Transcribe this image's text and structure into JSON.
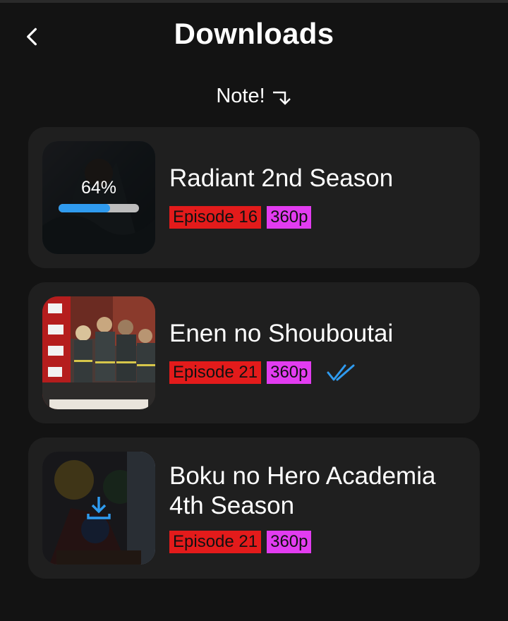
{
  "header": {
    "title": "Downloads",
    "back_icon": "chevron-left-icon"
  },
  "note": {
    "label": "Note!",
    "icon": "arrow-right-down-icon"
  },
  "colors": {
    "background": "#131313",
    "card": "#1f1f1f",
    "episode_badge": "#e31b1b",
    "quality_badge": "#e23cf0",
    "accent": "#2f9bef"
  },
  "downloads": [
    {
      "title": "Radiant 2nd Season",
      "episode": "Episode 16",
      "quality": "360p",
      "status": "downloading",
      "progress_label": "64%",
      "progress": 0.64
    },
    {
      "title": "Enen no Shouboutai",
      "episode": "Episode 21",
      "quality": "360p",
      "status": "completed",
      "status_icon": "double-check-icon"
    },
    {
      "title": "Boku no Hero Academia 4th Season",
      "episode": "Episode 21",
      "quality": "360p",
      "status": "queued",
      "status_icon": "download-icon"
    }
  ]
}
